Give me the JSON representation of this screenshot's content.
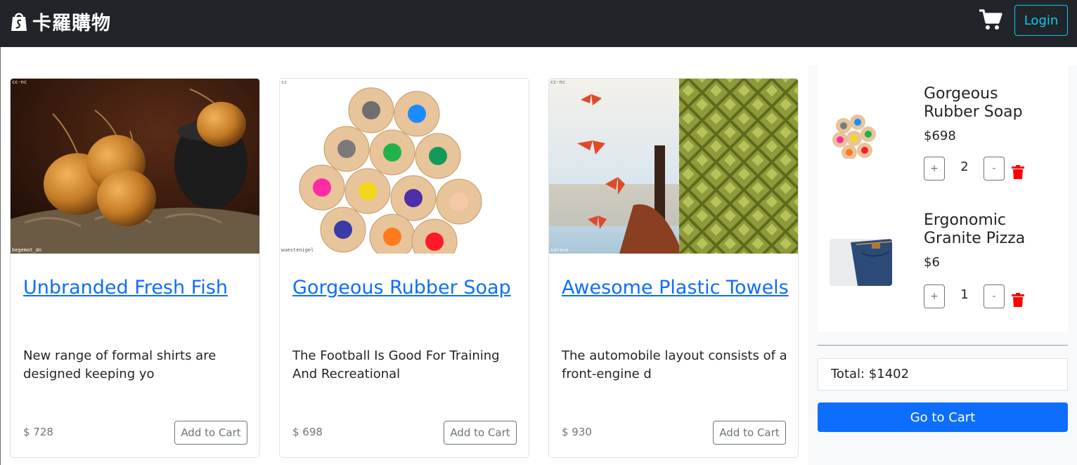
{
  "navbar": {
    "brand_text": "卡羅購物",
    "brand_icon": "shopify-bag-icon",
    "cart_icon": "shopping-cart-icon",
    "login_label": "Login",
    "bg_color": "#212529",
    "accent_color": "#0dcaf0"
  },
  "products": [
    {
      "title": "Unbranded Fresh Fish",
      "description": "New range of formal shirts are designed keeping yo",
      "price": "$ 728",
      "add_label": "Add to Cart",
      "image_tag": "cc-nc",
      "image_credit": "begemot_dn",
      "image": "onions-in-pot"
    },
    {
      "title": "Gorgeous Rubber Soap",
      "description": "The Football Is Good For Training And Recreational",
      "price": "$ 698",
      "add_label": "Add to Cart",
      "image_tag": "cc",
      "image_credit": "wuestenigel",
      "image": "colored-pencils"
    },
    {
      "title": "Awesome Plastic Towels",
      "description": "The automobile layout consists of a front-engine d",
      "price": "$ 930",
      "add_label": "Add to Cart",
      "image_tag": "cc-nc",
      "image_credit": "sarace",
      "image": "butterflies-and-glass"
    }
  ],
  "cart": {
    "items": [
      {
        "name": "Gorgeous Rubber Soap",
        "price": "$698",
        "quantity": "2",
        "plus_label": "+",
        "minus_label": "-",
        "delete_icon": "trash-icon",
        "image": "colored-pencils"
      },
      {
        "name": "Ergonomic Granite Pizza",
        "price": "$6",
        "quantity": "1",
        "plus_label": "+",
        "minus_label": "-",
        "delete_icon": "trash-icon",
        "image": "jeans"
      }
    ],
    "total": "Total: $1402",
    "go_label": "Go to Cart",
    "button_color": "#0d6efd",
    "delete_color": "#ff0000"
  }
}
